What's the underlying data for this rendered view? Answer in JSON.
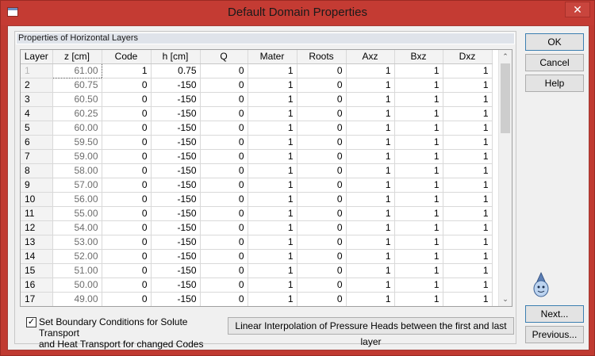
{
  "window": {
    "title": "Default Domain Properties",
    "close_glyph": "✕"
  },
  "group": {
    "title": "Properties of Horizontal Layers"
  },
  "table": {
    "columns": [
      "Layer",
      "z [cm]",
      "Code",
      "h [cm]",
      "Q",
      "Mater",
      "Roots",
      "Axz",
      "Bxz",
      "Dxz"
    ],
    "rows": [
      [
        "1",
        "61.00",
        "1",
        "0.75",
        "0",
        "1",
        "0",
        "1",
        "1",
        "1"
      ],
      [
        "2",
        "60.75",
        "0",
        "-150",
        "0",
        "1",
        "0",
        "1",
        "1",
        "1"
      ],
      [
        "3",
        "60.50",
        "0",
        "-150",
        "0",
        "1",
        "0",
        "1",
        "1",
        "1"
      ],
      [
        "4",
        "60.25",
        "0",
        "-150",
        "0",
        "1",
        "0",
        "1",
        "1",
        "1"
      ],
      [
        "5",
        "60.00",
        "0",
        "-150",
        "0",
        "1",
        "0",
        "1",
        "1",
        "1"
      ],
      [
        "6",
        "59.50",
        "0",
        "-150",
        "0",
        "1",
        "0",
        "1",
        "1",
        "1"
      ],
      [
        "7",
        "59.00",
        "0",
        "-150",
        "0",
        "1",
        "0",
        "1",
        "1",
        "1"
      ],
      [
        "8",
        "58.00",
        "0",
        "-150",
        "0",
        "1",
        "0",
        "1",
        "1",
        "1"
      ],
      [
        "9",
        "57.00",
        "0",
        "-150",
        "0",
        "1",
        "0",
        "1",
        "1",
        "1"
      ],
      [
        "10",
        "56.00",
        "0",
        "-150",
        "0",
        "1",
        "0",
        "1",
        "1",
        "1"
      ],
      [
        "11",
        "55.00",
        "0",
        "-150",
        "0",
        "1",
        "0",
        "1",
        "1",
        "1"
      ],
      [
        "12",
        "54.00",
        "0",
        "-150",
        "0",
        "1",
        "0",
        "1",
        "1",
        "1"
      ],
      [
        "13",
        "53.00",
        "0",
        "-150",
        "0",
        "1",
        "0",
        "1",
        "1",
        "1"
      ],
      [
        "14",
        "52.00",
        "0",
        "-150",
        "0",
        "1",
        "0",
        "1",
        "1",
        "1"
      ],
      [
        "15",
        "51.00",
        "0",
        "-150",
        "0",
        "1",
        "0",
        "1",
        "1",
        "1"
      ],
      [
        "16",
        "50.00",
        "0",
        "-150",
        "0",
        "1",
        "0",
        "1",
        "1",
        "1"
      ],
      [
        "17",
        "49.00",
        "0",
        "-150",
        "0",
        "1",
        "0",
        "1",
        "1",
        "1"
      ]
    ]
  },
  "scroll": {
    "up_glyph": "⌃",
    "down_glyph": "⌄"
  },
  "checkbox": {
    "checked": true,
    "glyph": "✓",
    "label_line1": "Set Boundary Conditions for Solute Transport",
    "label_line2": "and Heat Transport for changed Codes"
  },
  "buttons": {
    "interp": "Linear Interpolation of Pressure Heads between the first and last layer",
    "ok": "OK",
    "cancel": "Cancel",
    "help": "Help",
    "next": "Next...",
    "previous": "Previous..."
  }
}
